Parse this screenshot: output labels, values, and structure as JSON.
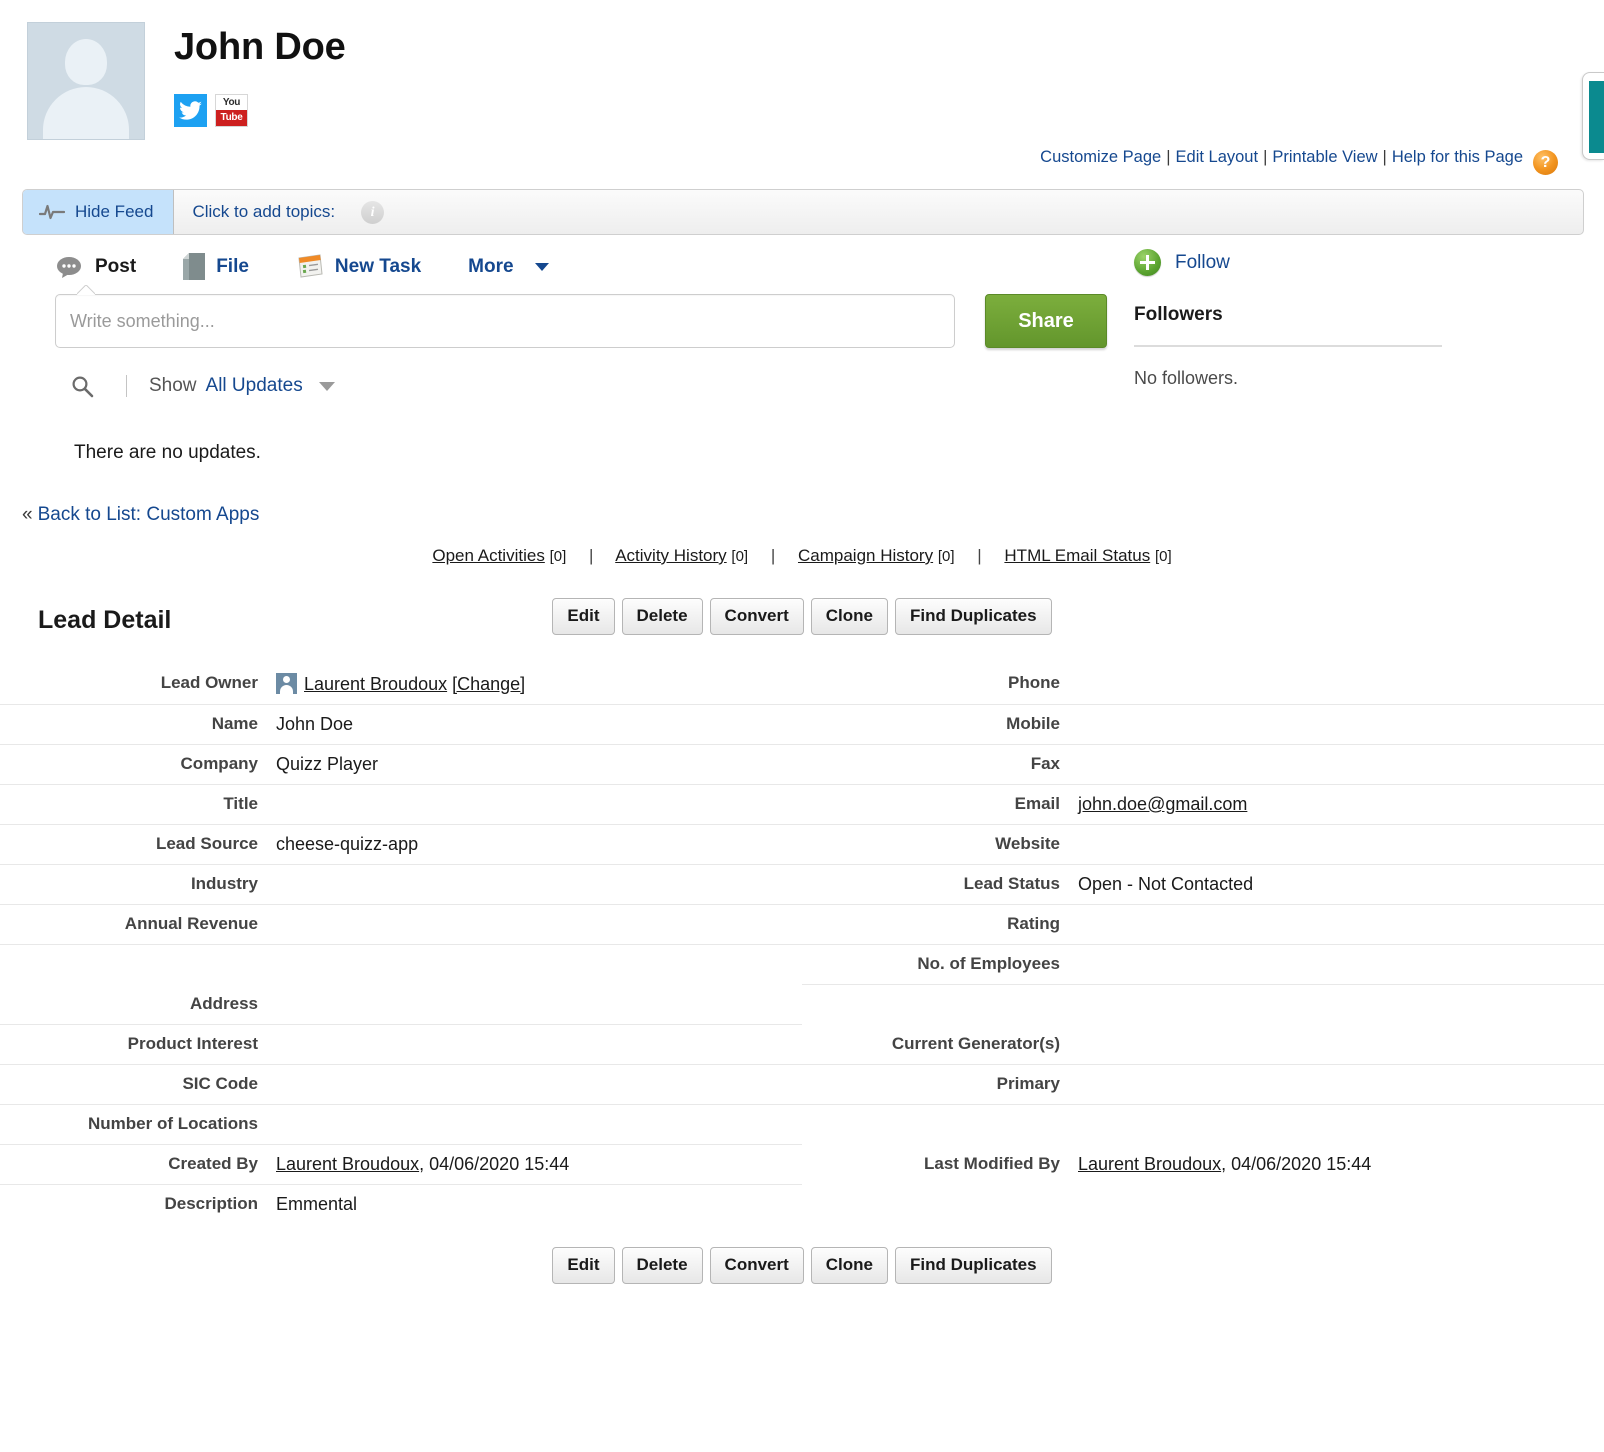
{
  "header": {
    "lead_name": "John Doe",
    "avatar_alt": "lead-photo-placeholder",
    "social": [
      {
        "name": "twitter",
        "label": ""
      },
      {
        "name": "youtube",
        "top": "You",
        "bottom": "Tube"
      }
    ],
    "links": [
      {
        "label": "Customize Page"
      },
      {
        "label": "Edit Layout"
      },
      {
        "label": "Printable View"
      },
      {
        "label": "Help for this Page"
      }
    ],
    "help_glyph": "?"
  },
  "feedbar": {
    "hide_feed": "Hide Feed",
    "topics_label": "Click to add topics:",
    "info_glyph": "i"
  },
  "publisher": {
    "tabs": [
      {
        "label": "Post",
        "icon": "comment-icon",
        "active": true
      },
      {
        "label": "File",
        "icon": "file-icon",
        "active": false
      },
      {
        "label": "New Task",
        "icon": "task-icon",
        "active": false
      },
      {
        "label": "More",
        "icon": "chevron-down-icon",
        "active": false
      }
    ],
    "input_placeholder": "Write something...",
    "input_value": "",
    "share_label": "Share"
  },
  "follow": {
    "follow_label": "Follow",
    "followers_heading": "Followers",
    "no_followers": "No followers."
  },
  "filter": {
    "show_label": "Show",
    "show_value": "All Updates"
  },
  "feed": {
    "empty_message": "There are no updates."
  },
  "back_link": {
    "chevron": "«",
    "label": "Back to List: Custom Apps"
  },
  "activity_links": [
    {
      "label": "Open Activities",
      "count": "[0]"
    },
    {
      "label": "Activity History",
      "count": "[0]"
    },
    {
      "label": "Campaign History",
      "count": "[0]"
    },
    {
      "label": "HTML Email Status",
      "count": "[0]"
    }
  ],
  "activity_separator": "|",
  "detail": {
    "title": "Lead Detail",
    "buttons": [
      {
        "label": "Edit"
      },
      {
        "label": "Delete"
      },
      {
        "label": "Convert"
      },
      {
        "label": "Clone"
      },
      {
        "label": "Find Duplicates"
      }
    ],
    "rows": [
      {
        "left": {
          "label": "Lead Owner",
          "value": "Laurent Broudoux",
          "link": true,
          "owner_icon": true,
          "change": "[Change]",
          "line": true
        },
        "right": {
          "label": "Phone",
          "value": "",
          "line": true
        }
      },
      {
        "left": {
          "label": "Name",
          "value": "John Doe",
          "line": true
        },
        "right": {
          "label": "Mobile",
          "value": "",
          "line": true
        }
      },
      {
        "left": {
          "label": "Company",
          "value": "Quizz Player",
          "line": true
        },
        "right": {
          "label": "Fax",
          "value": "",
          "line": true
        }
      },
      {
        "left": {
          "label": "Title",
          "value": "",
          "line": true
        },
        "right": {
          "label": "Email",
          "value": "john.doe@gmail.com",
          "link": true,
          "line": true
        }
      },
      {
        "left": {
          "label": "Lead Source",
          "value": "cheese-quizz-app",
          "line": true
        },
        "right": {
          "label": "Website",
          "value": "",
          "line": true
        }
      },
      {
        "left": {
          "label": "Industry",
          "value": "",
          "line": true
        },
        "right": {
          "label": "Lead Status",
          "value": "Open - Not Contacted",
          "line": true
        }
      },
      {
        "left": {
          "label": "Annual Revenue",
          "value": "",
          "line": true
        },
        "right": {
          "label": "Rating",
          "value": "",
          "line": true
        }
      },
      {
        "left": {
          "label": "",
          "value": "",
          "line": false
        },
        "right": {
          "label": "No. of Employees",
          "value": "",
          "line": true
        }
      },
      {
        "left": {
          "label": "Address",
          "value": "",
          "line": true
        },
        "right": {
          "label": "",
          "value": "",
          "line": false
        }
      },
      {
        "left": {
          "label": "Product Interest",
          "value": "",
          "line": true
        },
        "right": {
          "label": "Current Generator(s)",
          "value": "",
          "line": true
        }
      },
      {
        "left": {
          "label": "SIC Code",
          "value": "",
          "line": true
        },
        "right": {
          "label": "Primary",
          "value": "",
          "line": true
        }
      },
      {
        "left": {
          "label": "Number of Locations",
          "value": "",
          "line": true
        },
        "right": {
          "label": "",
          "value": "",
          "line": false
        }
      },
      {
        "left": {
          "label": "Created By",
          "value": "Laurent Broudoux",
          "link": true,
          "suffix": ", 04/06/2020 15:44",
          "line": true
        },
        "right": {
          "label": "Last Modified By",
          "value": "Laurent Broudoux",
          "link": true,
          "suffix": ", 04/06/2020 15:44",
          "line": false
        }
      },
      {
        "left": {
          "label": "Description",
          "value": "Emmental",
          "line": false
        },
        "right": {
          "label": "",
          "value": "",
          "line": false
        }
      }
    ]
  },
  "colors": {
    "link_blue": "#15488f",
    "share_green": "#6ea233",
    "hide_feed_bg": "#c5e2fb",
    "twitter_blue": "#1da1f2",
    "youtube_red": "#cd201f",
    "help_orange": "#f2941f"
  }
}
